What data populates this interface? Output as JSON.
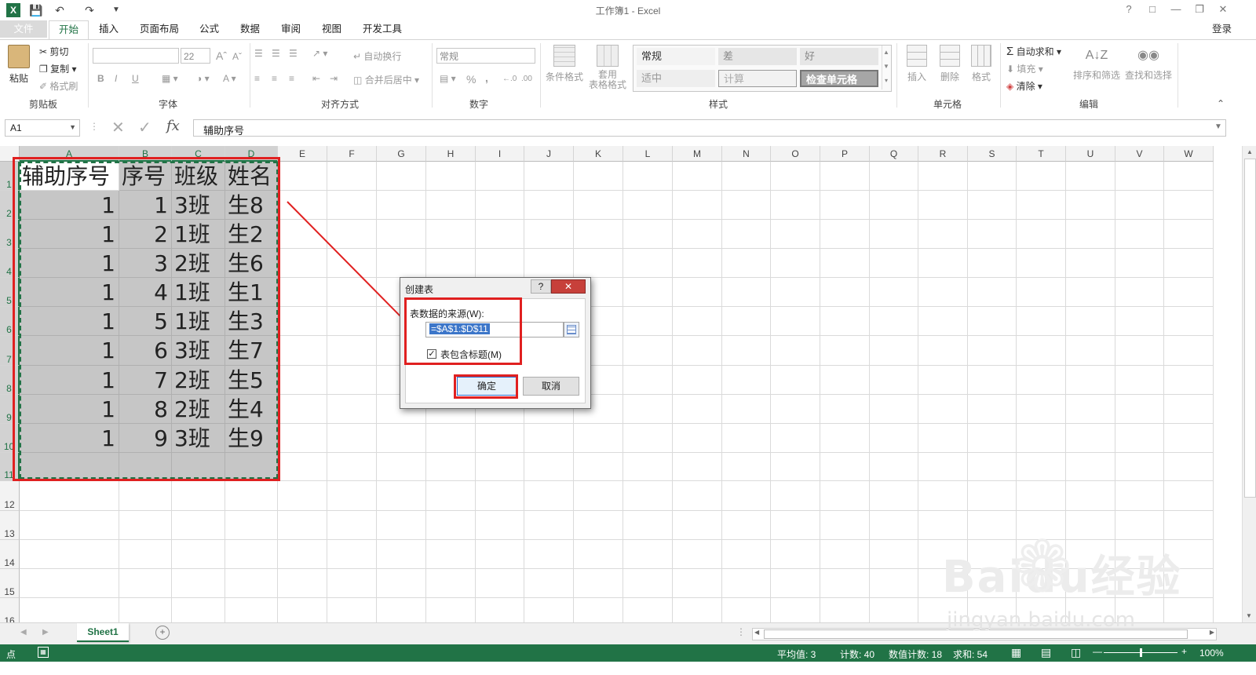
{
  "app": {
    "title": "工作簿1 - Excel",
    "login": "登录",
    "help": "?",
    "window_controls": [
      "restore-ribbon-icon",
      "minimize-icon",
      "maximize-icon",
      "close-icon"
    ]
  },
  "tabs": [
    "文件",
    "开始",
    "插入",
    "页面布局",
    "公式",
    "数据",
    "审阅",
    "视图",
    "开发工具"
  ],
  "ribbon": {
    "clipboard": {
      "paste": "粘贴",
      "cut": "剪切",
      "copy": "复制",
      "format_painter": "格式刷",
      "label": "剪贴板"
    },
    "font": {
      "size": "22",
      "bold": "B",
      "italic": "I",
      "underline": "U",
      "label": "字体"
    },
    "alignment": {
      "wrap": "自动换行",
      "merge": "合并后居中",
      "label": "对齐方式"
    },
    "number": {
      "format": "常规",
      "percent": "%",
      "comma": ",",
      "label": "数字"
    },
    "styles": {
      "conditional": "条件格式",
      "table_format_1": "套用",
      "table_format_2": "表格格式",
      "normal": "常规",
      "bad": "差",
      "good": "好",
      "neutral": "适中",
      "calculation": "计算",
      "check_cell": "检查单元格",
      "label": "样式"
    },
    "cells": {
      "insert": "插入",
      "delete": "删除",
      "format": "格式",
      "label": "单元格"
    },
    "editing": {
      "autosum": "自动求和",
      "fill": "填充",
      "clear": "清除",
      "sort": "排序和筛选",
      "find": "查找和选择",
      "label": "编辑"
    }
  },
  "formula_bar": {
    "name_box": "A1",
    "fx": "fx",
    "content": "辅助序号"
  },
  "grid": {
    "columns": [
      "A",
      "B",
      "C",
      "D",
      "E",
      "F",
      "G",
      "H",
      "I",
      "J",
      "K",
      "L",
      "M",
      "N",
      "O",
      "P",
      "Q",
      "R",
      "S",
      "T",
      "U",
      "V",
      "W"
    ],
    "rows": [
      "1",
      "2",
      "3",
      "4",
      "5",
      "6",
      "7",
      "8",
      "9",
      "10",
      "11",
      "12",
      "13",
      "14",
      "15",
      "16"
    ],
    "header_row": [
      "辅助序号",
      "序号",
      "班级",
      "姓名"
    ],
    "data": [
      [
        "1",
        "1",
        "3班",
        "生8"
      ],
      [
        "1",
        "2",
        "1班",
        "生2"
      ],
      [
        "1",
        "3",
        "2班",
        "生6"
      ],
      [
        "1",
        "4",
        "1班",
        "生1"
      ],
      [
        "1",
        "5",
        "1班",
        "生3"
      ],
      [
        "1",
        "6",
        "3班",
        "生7"
      ],
      [
        "1",
        "7",
        "2班",
        "生5"
      ],
      [
        "1",
        "8",
        "2班",
        "生4"
      ],
      [
        "1",
        "9",
        "3班",
        "生9"
      ]
    ]
  },
  "dialog": {
    "title": "创建表",
    "help": "?",
    "source_label": "表数据的来源(W):",
    "source_value": "=$A$1:$D$11",
    "has_headers": "表包含标题(M)",
    "ok": "确定",
    "cancel": "取消"
  },
  "sheet_tabs": [
    "Sheet1"
  ],
  "status": {
    "mode": "点",
    "average": "平均值: 3",
    "count": "计数: 40",
    "numeric_count": "数值计数: 18",
    "sum": "求和: 54",
    "zoom": "100%"
  },
  "watermark": {
    "brand": "Baidu经验",
    "url": "jingyan.baidu.com"
  },
  "colors": {
    "excel_green": "#217346",
    "annotation_red": "#e02020",
    "selection_gray": "#c6c6c6"
  }
}
